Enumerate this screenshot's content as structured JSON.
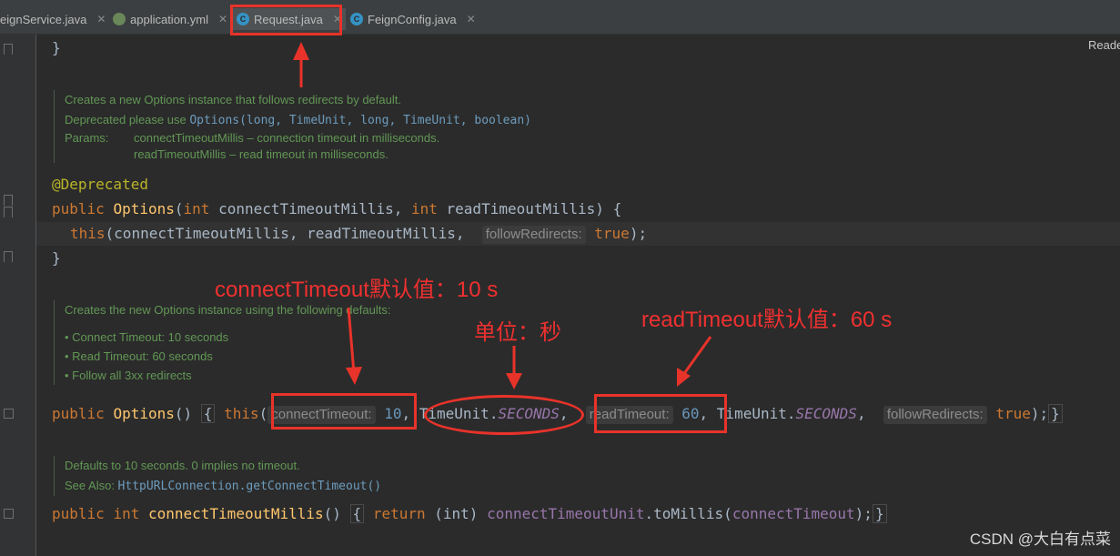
{
  "tabs": [
    {
      "label": "eignService.java",
      "icon": "interface-icon",
      "active": false
    },
    {
      "label": "application.yml",
      "icon": "spring-leaf-icon",
      "active": false
    },
    {
      "label": "Request.java",
      "icon": "class-icon",
      "active": true
    },
    {
      "label": "FeignConfig.java",
      "icon": "class-icon",
      "active": false
    }
  ],
  "reader_mode_label": "Reade",
  "doc1": {
    "line1": "Creates a new Options instance that follows redirects by default.",
    "deprecated_prefix": "Deprecated please use ",
    "deprecated_link": "Options(long, TimeUnit, long, TimeUnit, boolean)",
    "params_label": "Params:",
    "param1": "connectTimeoutMillis – connection timeout in milliseconds.",
    "param2": "readTimeoutMillis – read timeout in milliseconds."
  },
  "doc2": {
    "line1": "Creates the new Options instance using the following defaults:",
    "bullets": [
      "Connect Timeout: 10 seconds",
      "Read Timeout: 60 seconds",
      "Follow all 3xx redirects"
    ]
  },
  "doc3": {
    "line1": "Defaults to 10 seconds. 0 implies no timeout.",
    "see_also_label": "See Also: ",
    "see_also_link": "HttpURLConnection.getConnectTimeout()"
  },
  "code": {
    "close_brace": "}",
    "annotation": "@Deprecated",
    "kw_public": "public",
    "kw_int": "int",
    "kw_this": "this",
    "kw_return": "return",
    "fn_options": "Options",
    "fn_ctm": "connectTimeoutMillis",
    "param_ctm": "connectTimeoutMillis",
    "param_rtm": "readTimeoutMillis",
    "hint_follow": "followRedirects:",
    "hint_connect": "connectTimeout:",
    "hint_read": "readTimeout:",
    "val_true": "true",
    "val_10": "10",
    "val_60": "60",
    "timeunit": "TimeUnit",
    "seconds": "SECONDS",
    "cast_int": "(int)",
    "field_unit": "connectTimeoutUnit",
    "method_tomillis": "toMillis",
    "field_ct": "connectTimeout"
  },
  "annotations": {
    "connect": "connectTimeout默认值：10 s",
    "unit": "单位：秒",
    "read": "readTimeout默认值：60 s"
  },
  "watermark": "CSDN @大白有点菜",
  "colors": {
    "annotation_red": "#e8332a",
    "doc_green": "#629755",
    "keyword": "#cc7832"
  }
}
